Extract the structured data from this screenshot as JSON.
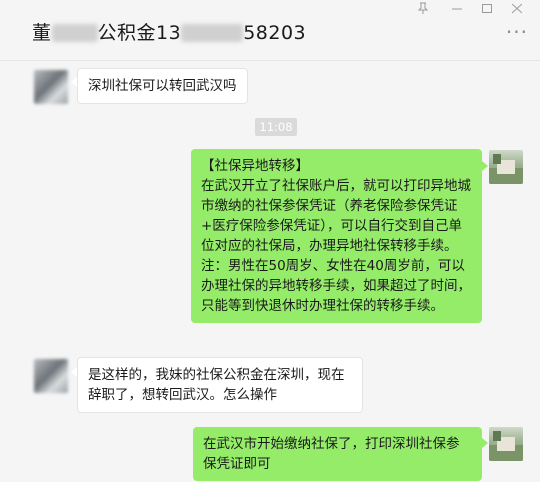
{
  "header": {
    "title_prefix": "董",
    "title_middle": "公积金13",
    "title_suffix": "58203",
    "icons": [
      "pin-icon",
      "minimize-icon",
      "maximize-icon",
      "close-icon"
    ],
    "more_label": "···"
  },
  "messages": [
    {
      "side": "in",
      "text": "深圳社保可以转回武汉吗"
    },
    {
      "side": "time",
      "text": "11:08"
    },
    {
      "side": "out",
      "text": "【社保异地转移】\n在武汉开立了社保账户后，就可以打印异地城市缴纳的社保参保凭证（养老保险参保凭证+医疗保险参保凭证），可以自行交到自己单位对应的社保局，办理异地社保转移手续。注：男性在50周岁、女性在40周岁前，可以办理社保的异地转移手续，如果超过了时间，只能等到快退休时办理社保的转移手续。"
    },
    {
      "side": "in",
      "text": "是这样的，我妹的社保公积金在深圳，现在辞职了，想转回武汉。怎么操作"
    },
    {
      "side": "out",
      "text": "在武汉市开始缴纳社保了，打印深圳社保参保凭证即可"
    }
  ],
  "colors": {
    "out_bubble": "#95ec69",
    "in_bubble": "#ffffff",
    "background": "#f5f5f5"
  }
}
